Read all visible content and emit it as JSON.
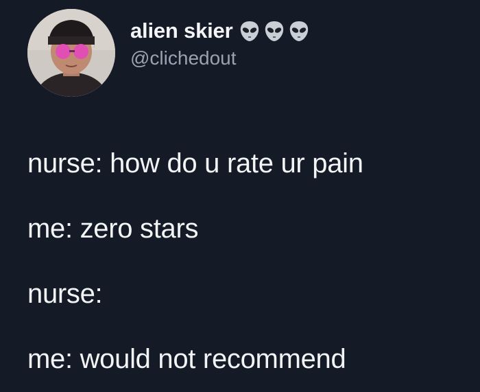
{
  "tweet": {
    "author": {
      "display_name": "alien skier",
      "handle": "@clichedout",
      "name_emojis": [
        "alien-icon",
        "alien-icon",
        "alien-icon"
      ]
    },
    "lines": [
      "nurse: how do u rate ur pain",
      "me: zero stars",
      "nurse:",
      "me: would not recommend"
    ]
  },
  "colors": {
    "background": "#141b27",
    "text": "#f3f4f6",
    "handle": "#9aa3b0"
  }
}
